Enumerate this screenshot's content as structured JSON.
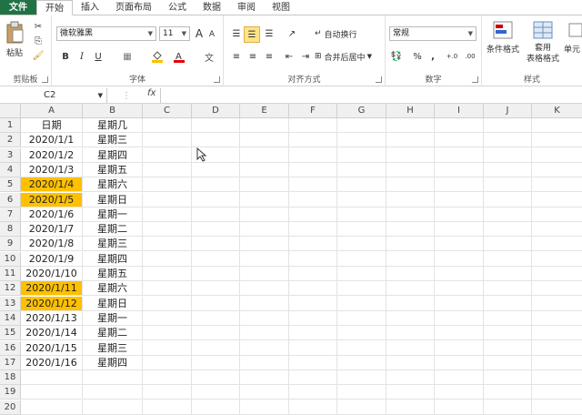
{
  "tabs": [
    "文件",
    "开始",
    "插入",
    "页面布局",
    "公式",
    "数据",
    "审阅",
    "视图"
  ],
  "ribbon": {
    "clipboard": {
      "paste": "粘贴",
      "label": "剪贴板"
    },
    "font": {
      "name": "微软雅黑",
      "size": "11",
      "bold": "B",
      "italic": "I",
      "underline": "U",
      "grow": "A",
      "shrink": "A",
      "label": "字体"
    },
    "alignment": {
      "wrap": "自动换行",
      "merge": "合并后居中",
      "label": "对齐方式"
    },
    "number": {
      "format": "常规",
      "percent": "%",
      "comma": ",",
      "inc": "+.0",
      "dec": ".00",
      "label": "数字"
    },
    "styles": {
      "conditional": "条件格式",
      "table": "套用\n表格格式",
      "cell": "单元",
      "label": "样式"
    }
  },
  "formula_bar": {
    "name_box": "C2",
    "fx": "fx",
    "value": ""
  },
  "columns": [
    "A",
    "B",
    "C",
    "D",
    "E",
    "F",
    "G",
    "H",
    "I",
    "J",
    "K"
  ],
  "rows": [
    {
      "n": "1",
      "a": "日期",
      "b": "星期几",
      "hl": false
    },
    {
      "n": "2",
      "a": "2020/1/1",
      "b": "星期三",
      "hl": false
    },
    {
      "n": "3",
      "a": "2020/1/2",
      "b": "星期四",
      "hl": false
    },
    {
      "n": "4",
      "a": "2020/1/3",
      "b": "星期五",
      "hl": false
    },
    {
      "n": "5",
      "a": "2020/1/4",
      "b": "星期六",
      "hl": true
    },
    {
      "n": "6",
      "a": "2020/1/5",
      "b": "星期日",
      "hl": true
    },
    {
      "n": "7",
      "a": "2020/1/6",
      "b": "星期一",
      "hl": false
    },
    {
      "n": "8",
      "a": "2020/1/7",
      "b": "星期二",
      "hl": false
    },
    {
      "n": "9",
      "a": "2020/1/8",
      "b": "星期三",
      "hl": false
    },
    {
      "n": "10",
      "a": "2020/1/9",
      "b": "星期四",
      "hl": false
    },
    {
      "n": "11",
      "a": "2020/1/10",
      "b": "星期五",
      "hl": false
    },
    {
      "n": "12",
      "a": "2020/1/11",
      "b": "星期六",
      "hl": true
    },
    {
      "n": "13",
      "a": "2020/1/12",
      "b": "星期日",
      "hl": true
    },
    {
      "n": "14",
      "a": "2020/1/13",
      "b": "星期一",
      "hl": false
    },
    {
      "n": "15",
      "a": "2020/1/14",
      "b": "星期二",
      "hl": false
    },
    {
      "n": "16",
      "a": "2020/1/15",
      "b": "星期三",
      "hl": false
    },
    {
      "n": "17",
      "a": "2020/1/16",
      "b": "星期四",
      "hl": false
    },
    {
      "n": "18",
      "a": "",
      "b": "",
      "hl": false
    },
    {
      "n": "19",
      "a": "",
      "b": "",
      "hl": false
    },
    {
      "n": "20",
      "a": "",
      "b": "",
      "hl": false
    }
  ],
  "colors": {
    "highlight": "#ffc000",
    "file_tab": "#217346"
  }
}
